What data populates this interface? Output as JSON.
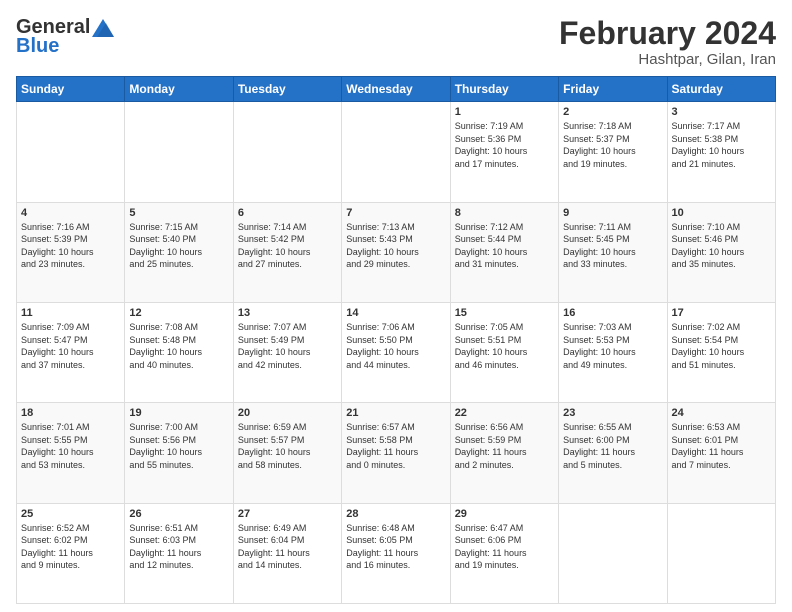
{
  "header": {
    "logo_general": "General",
    "logo_blue": "Blue",
    "title": "February 2024",
    "subtitle": "Hashtpar, Gilan, Iran"
  },
  "days_of_week": [
    "Sunday",
    "Monday",
    "Tuesday",
    "Wednesday",
    "Thursday",
    "Friday",
    "Saturday"
  ],
  "weeks": [
    {
      "days": [
        {
          "num": "",
          "info": ""
        },
        {
          "num": "",
          "info": ""
        },
        {
          "num": "",
          "info": ""
        },
        {
          "num": "",
          "info": ""
        },
        {
          "num": "1",
          "info": "Sunrise: 7:19 AM\nSunset: 5:36 PM\nDaylight: 10 hours\nand 17 minutes."
        },
        {
          "num": "2",
          "info": "Sunrise: 7:18 AM\nSunset: 5:37 PM\nDaylight: 10 hours\nand 19 minutes."
        },
        {
          "num": "3",
          "info": "Sunrise: 7:17 AM\nSunset: 5:38 PM\nDaylight: 10 hours\nand 21 minutes."
        }
      ]
    },
    {
      "days": [
        {
          "num": "4",
          "info": "Sunrise: 7:16 AM\nSunset: 5:39 PM\nDaylight: 10 hours\nand 23 minutes."
        },
        {
          "num": "5",
          "info": "Sunrise: 7:15 AM\nSunset: 5:40 PM\nDaylight: 10 hours\nand 25 minutes."
        },
        {
          "num": "6",
          "info": "Sunrise: 7:14 AM\nSunset: 5:42 PM\nDaylight: 10 hours\nand 27 minutes."
        },
        {
          "num": "7",
          "info": "Sunrise: 7:13 AM\nSunset: 5:43 PM\nDaylight: 10 hours\nand 29 minutes."
        },
        {
          "num": "8",
          "info": "Sunrise: 7:12 AM\nSunset: 5:44 PM\nDaylight: 10 hours\nand 31 minutes."
        },
        {
          "num": "9",
          "info": "Sunrise: 7:11 AM\nSunset: 5:45 PM\nDaylight: 10 hours\nand 33 minutes."
        },
        {
          "num": "10",
          "info": "Sunrise: 7:10 AM\nSunset: 5:46 PM\nDaylight: 10 hours\nand 35 minutes."
        }
      ]
    },
    {
      "days": [
        {
          "num": "11",
          "info": "Sunrise: 7:09 AM\nSunset: 5:47 PM\nDaylight: 10 hours\nand 37 minutes."
        },
        {
          "num": "12",
          "info": "Sunrise: 7:08 AM\nSunset: 5:48 PM\nDaylight: 10 hours\nand 40 minutes."
        },
        {
          "num": "13",
          "info": "Sunrise: 7:07 AM\nSunset: 5:49 PM\nDaylight: 10 hours\nand 42 minutes."
        },
        {
          "num": "14",
          "info": "Sunrise: 7:06 AM\nSunset: 5:50 PM\nDaylight: 10 hours\nand 44 minutes."
        },
        {
          "num": "15",
          "info": "Sunrise: 7:05 AM\nSunset: 5:51 PM\nDaylight: 10 hours\nand 46 minutes."
        },
        {
          "num": "16",
          "info": "Sunrise: 7:03 AM\nSunset: 5:53 PM\nDaylight: 10 hours\nand 49 minutes."
        },
        {
          "num": "17",
          "info": "Sunrise: 7:02 AM\nSunset: 5:54 PM\nDaylight: 10 hours\nand 51 minutes."
        }
      ]
    },
    {
      "days": [
        {
          "num": "18",
          "info": "Sunrise: 7:01 AM\nSunset: 5:55 PM\nDaylight: 10 hours\nand 53 minutes."
        },
        {
          "num": "19",
          "info": "Sunrise: 7:00 AM\nSunset: 5:56 PM\nDaylight: 10 hours\nand 55 minutes."
        },
        {
          "num": "20",
          "info": "Sunrise: 6:59 AM\nSunset: 5:57 PM\nDaylight: 10 hours\nand 58 minutes."
        },
        {
          "num": "21",
          "info": "Sunrise: 6:57 AM\nSunset: 5:58 PM\nDaylight: 11 hours\nand 0 minutes."
        },
        {
          "num": "22",
          "info": "Sunrise: 6:56 AM\nSunset: 5:59 PM\nDaylight: 11 hours\nand 2 minutes."
        },
        {
          "num": "23",
          "info": "Sunrise: 6:55 AM\nSunset: 6:00 PM\nDaylight: 11 hours\nand 5 minutes."
        },
        {
          "num": "24",
          "info": "Sunrise: 6:53 AM\nSunset: 6:01 PM\nDaylight: 11 hours\nand 7 minutes."
        }
      ]
    },
    {
      "days": [
        {
          "num": "25",
          "info": "Sunrise: 6:52 AM\nSunset: 6:02 PM\nDaylight: 11 hours\nand 9 minutes."
        },
        {
          "num": "26",
          "info": "Sunrise: 6:51 AM\nSunset: 6:03 PM\nDaylight: 11 hours\nand 12 minutes."
        },
        {
          "num": "27",
          "info": "Sunrise: 6:49 AM\nSunset: 6:04 PM\nDaylight: 11 hours\nand 14 minutes."
        },
        {
          "num": "28",
          "info": "Sunrise: 6:48 AM\nSunset: 6:05 PM\nDaylight: 11 hours\nand 16 minutes."
        },
        {
          "num": "29",
          "info": "Sunrise: 6:47 AM\nSunset: 6:06 PM\nDaylight: 11 hours\nand 19 minutes."
        },
        {
          "num": "",
          "info": ""
        },
        {
          "num": "",
          "info": ""
        }
      ]
    }
  ]
}
